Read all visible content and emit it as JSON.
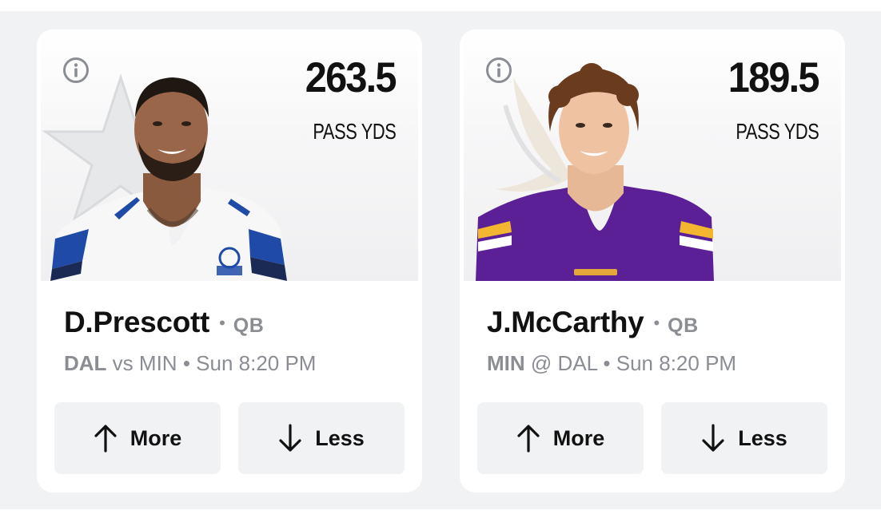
{
  "cards": [
    {
      "stat_value": "263.5",
      "stat_label": "PASS YDS",
      "player_name": "D.Prescott",
      "position": "QB",
      "team": "DAL",
      "matchup_sep": "vs",
      "opponent": "MIN",
      "game_time": "Sun 8:20 PM",
      "more_label": "More",
      "less_label": "Less",
      "jersey_color": "#ffffff",
      "team_accent": "#1f4aa8"
    },
    {
      "stat_value": "189.5",
      "stat_label": "PASS YDS",
      "player_name": "J.McCarthy",
      "position": "QB",
      "team": "MIN",
      "matchup_sep": "@",
      "opponent": "DAL",
      "game_time": "Sun 8:20 PM",
      "more_label": "More",
      "less_label": "Less",
      "jersey_color": "#5b1f96",
      "team_accent": "#f2b630"
    }
  ],
  "colors": {
    "background": "#f1f2f4",
    "card": "#ffffff",
    "text_primary": "#111111",
    "text_secondary": "#8a8d93",
    "button": "#f1f2f4"
  },
  "icons": [
    "info-icon",
    "arrow-up-icon",
    "arrow-down-icon",
    "dallas-star-logo",
    "vikings-horn-logo"
  ]
}
